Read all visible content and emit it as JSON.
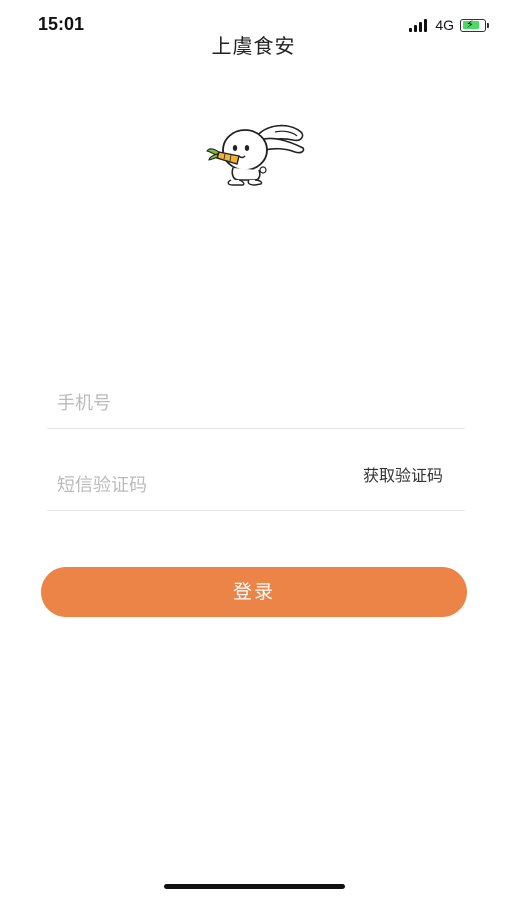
{
  "status_bar": {
    "time": "15:01",
    "network": "4G"
  },
  "header": {
    "title": "上虞食安"
  },
  "mascot": {
    "icon": "rabbit-mascot-icon"
  },
  "form": {
    "phone_placeholder": "手机号",
    "code_placeholder": "短信验证码",
    "get_code_label": "获取验证码"
  },
  "login": {
    "label": "登录"
  },
  "colors": {
    "accent": "#ec8447",
    "battery": "#4cd964"
  }
}
